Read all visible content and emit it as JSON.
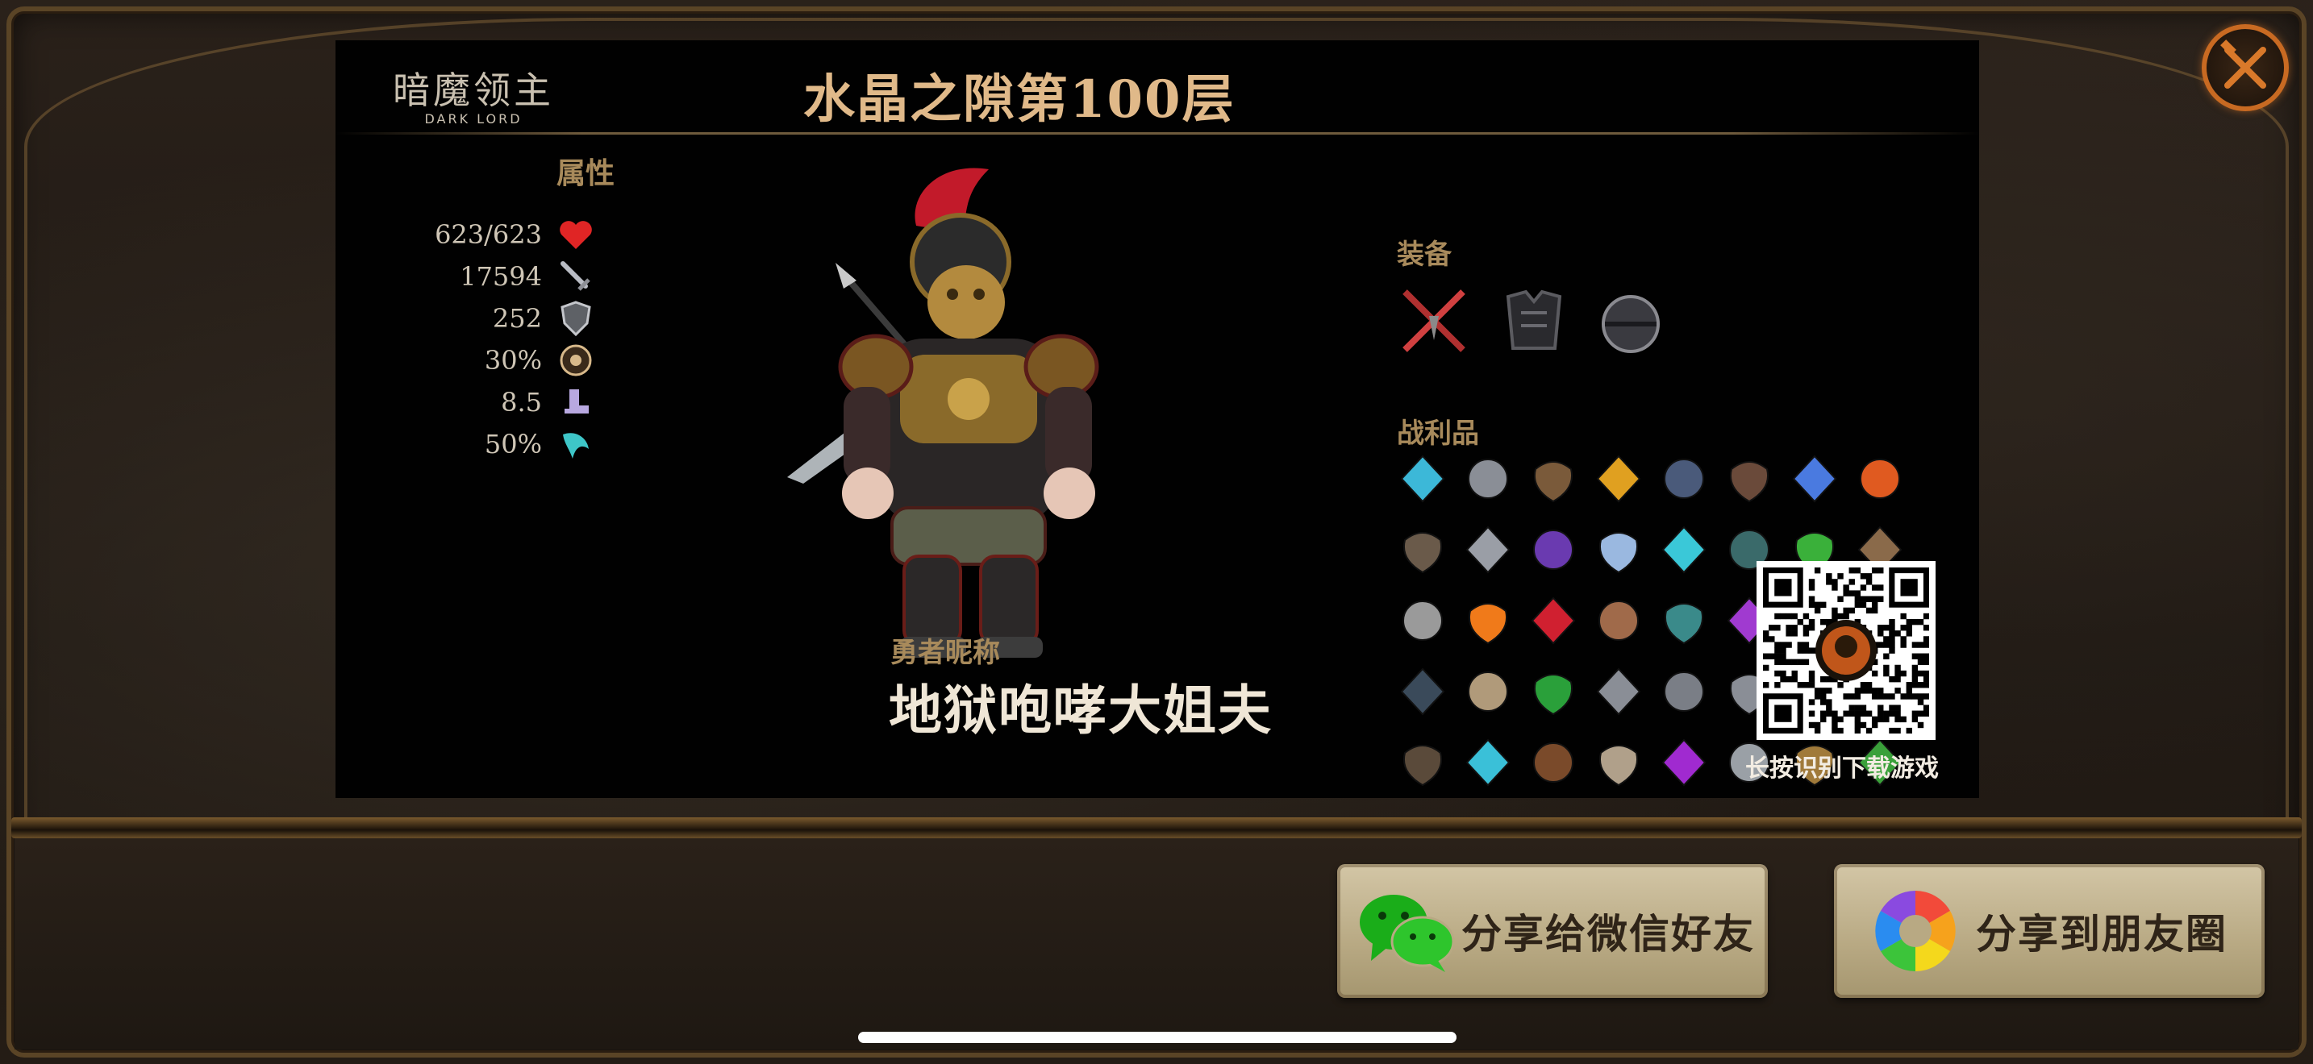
{
  "logo": {
    "cn": "暗魔领主",
    "en": "DARK LORD"
  },
  "stage_title": "水晶之隙第100层",
  "attributes": {
    "title": "属性",
    "items": [
      {
        "value": "623/623",
        "icon": "heart-icon"
      },
      {
        "value": "17594",
        "icon": "sword-icon"
      },
      {
        "value": "252",
        "icon": "shield-icon"
      },
      {
        "value": "30%",
        "icon": "crit-icon"
      },
      {
        "value": "8.5",
        "icon": "boot-icon"
      },
      {
        "value": "50%",
        "icon": "claw-icon"
      }
    ]
  },
  "hero": {
    "label": "勇者昵称",
    "name": "地狱咆哮大姐夫"
  },
  "equipment": {
    "title": "装备",
    "items": [
      "crossed-blades-icon",
      "chest-armor-icon",
      "helmet-orb-icon"
    ]
  },
  "loot": {
    "title": "战利品"
  },
  "qr": {
    "caption": "长按识别下载游戏"
  },
  "share": {
    "wechat_friend": "分享给微信好友",
    "moments": "分享到朋友圈"
  },
  "colors": {
    "accent": "#e0b989",
    "label": "#a88a5b",
    "close": "#c86a22"
  }
}
